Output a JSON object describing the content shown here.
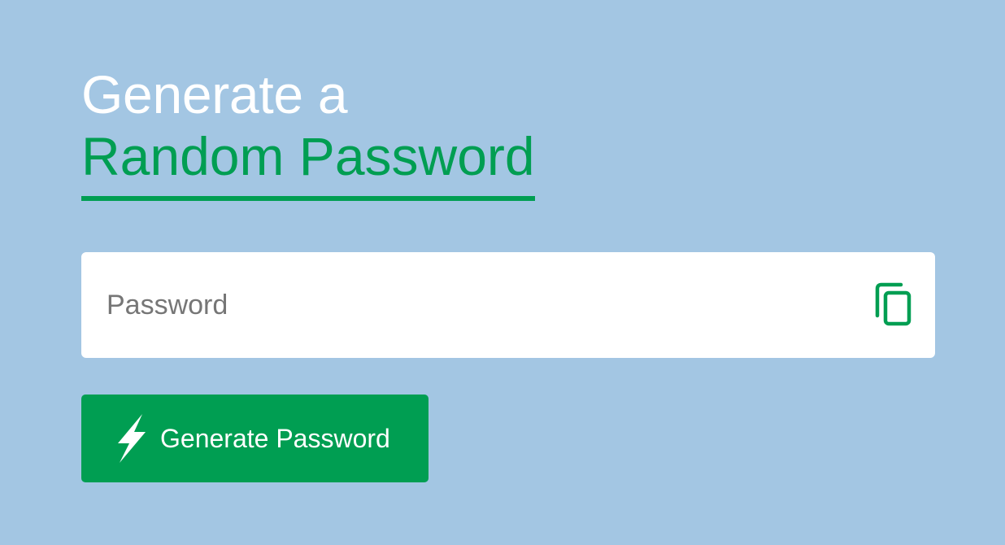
{
  "heading": {
    "line1": "Generate a",
    "line2": "Random Password"
  },
  "password_field": {
    "value": "",
    "placeholder": "Password"
  },
  "copy_button": {
    "icon": "copy-icon"
  },
  "generate_button": {
    "label": "Generate Password",
    "icon": "lightning-bolt-icon"
  },
  "colors": {
    "background": "#a3c6e3",
    "accent": "#009e52",
    "heading_text": "#ffffff",
    "field_background": "#ffffff",
    "placeholder_text": "#767676"
  }
}
